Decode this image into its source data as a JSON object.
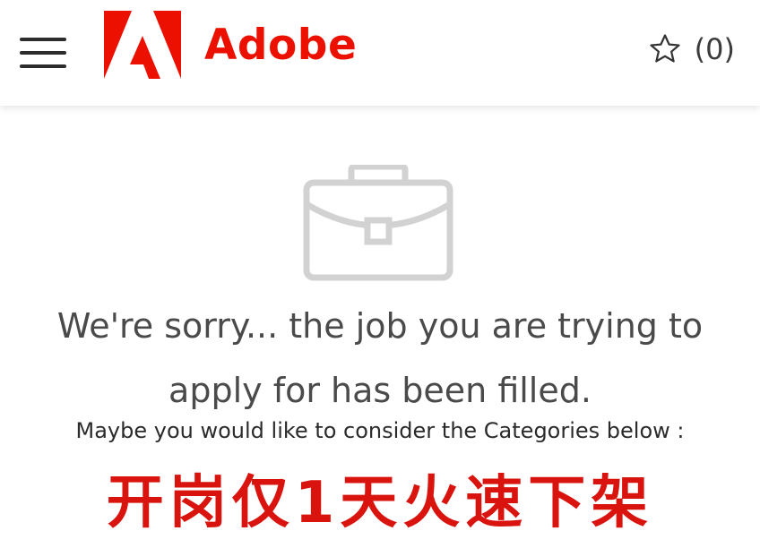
{
  "header": {
    "menu_icon": "hamburger-menu-icon",
    "logo_text": "Adobe",
    "logo_color": "#eb1000",
    "saved_icon": "star-outline-icon",
    "saved_count": "(0)"
  },
  "main": {
    "empty_icon": "briefcase-icon",
    "sorry_message": "We're sorry... the job you are trying to apply for has been filled.",
    "consider_text": "Maybe you would like to consider the Categories below :",
    "overlay_caption": "开岗仅1天火速下架",
    "overlay_color": "#d9140e"
  }
}
